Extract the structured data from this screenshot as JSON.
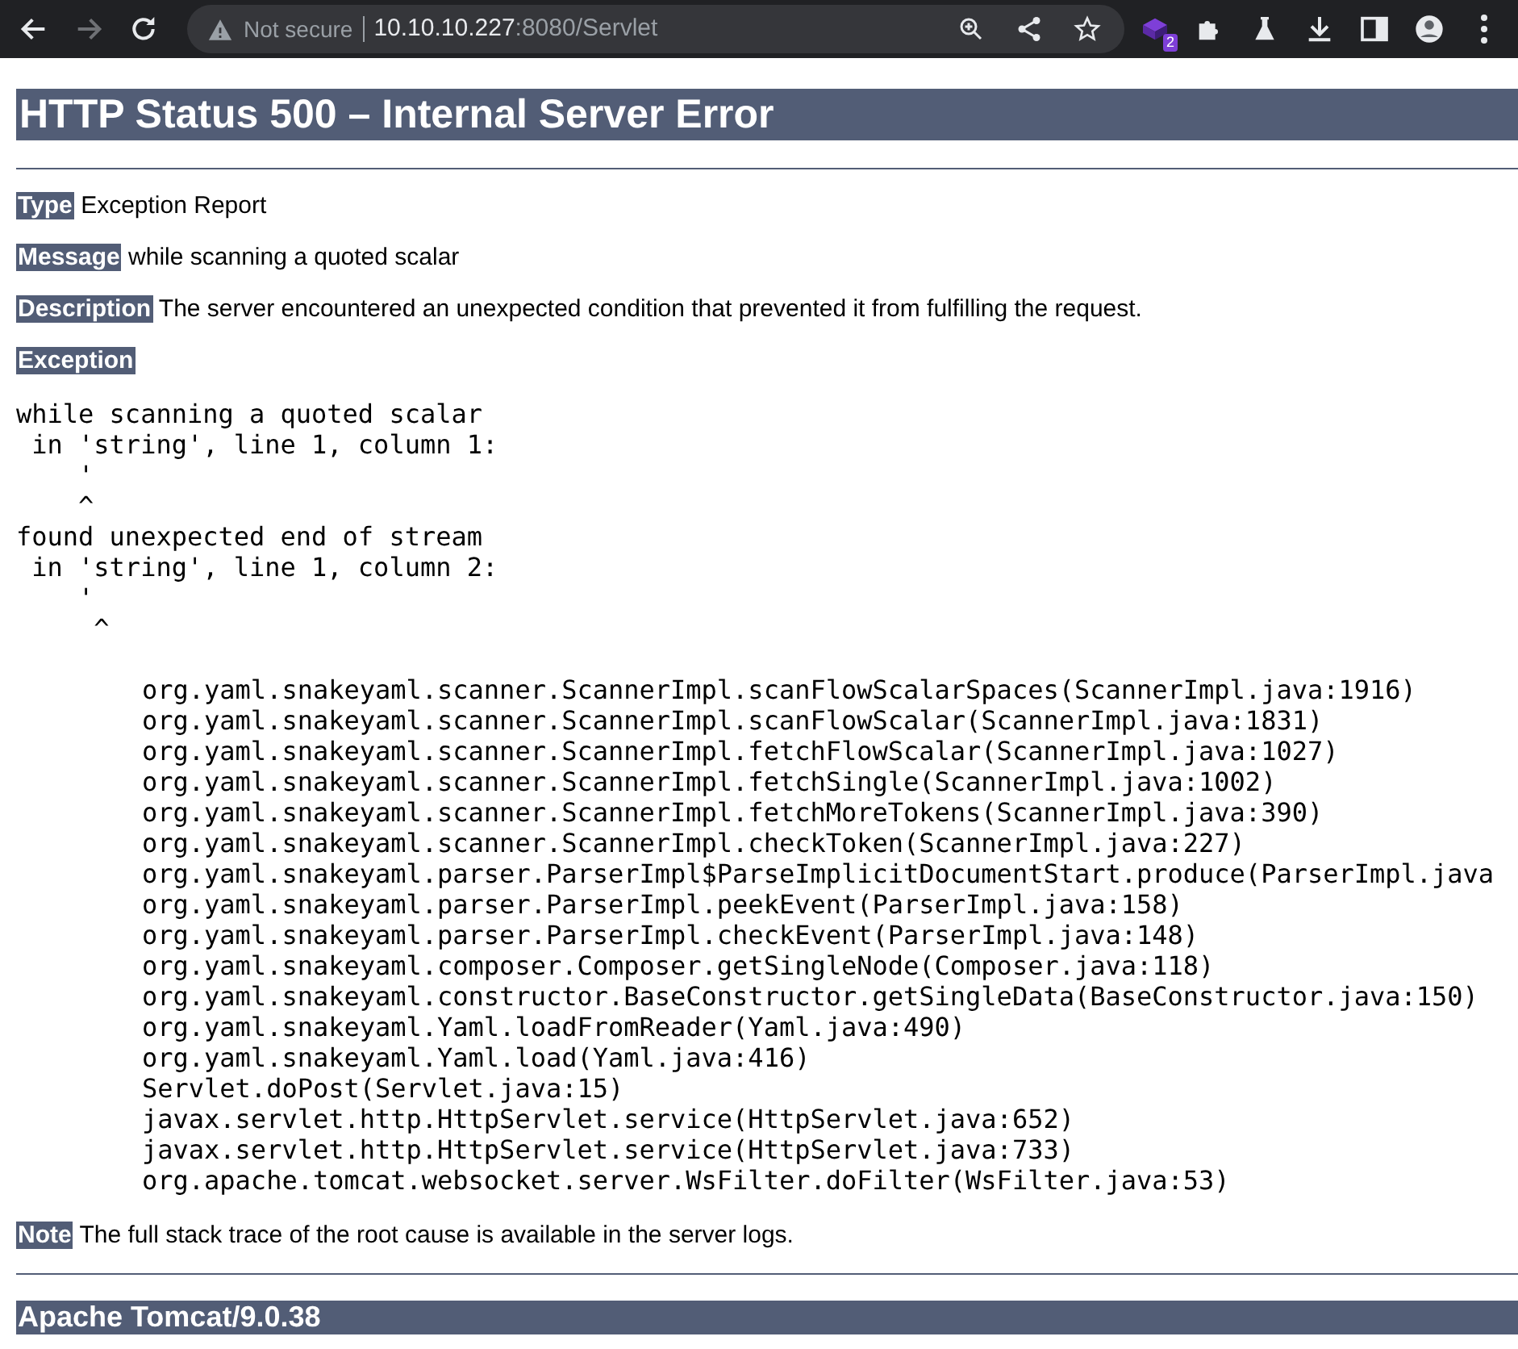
{
  "browser": {
    "nav_buttons": [
      {
        "kind": "back",
        "disabled": false
      },
      {
        "kind": "forward",
        "disabled": true
      },
      {
        "kind": "reload",
        "disabled": false
      }
    ],
    "security": "Not secure",
    "url_host": "10.10.10.227",
    "url_rest": ":8080/Servlet",
    "extension_badge": "2"
  },
  "page": {
    "title": "HTTP Status 500 – Internal Server Error",
    "fields": [
      {
        "label": "Type",
        "text": "Exception Report"
      },
      {
        "label": "Message",
        "text": "while scanning a quoted scalar"
      },
      {
        "label": "Description",
        "text": "The server encountered an unexpected condition that prevented it from fulfilling the request."
      }
    ],
    "exception_label": "Exception",
    "exception_message": [
      "while scanning a quoted scalar",
      " in 'string', line 1, column 1:",
      "    '",
      "    ^",
      "found unexpected end of stream",
      " in 'string', line 1, column 2:",
      "    '",
      "     ^"
    ],
    "stack_trace": [
      "org.yaml.snakeyaml.scanner.ScannerImpl.scanFlowScalarSpaces(ScannerImpl.java:1916)",
      "org.yaml.snakeyaml.scanner.ScannerImpl.scanFlowScalar(ScannerImpl.java:1831)",
      "org.yaml.snakeyaml.scanner.ScannerImpl.fetchFlowScalar(ScannerImpl.java:1027)",
      "org.yaml.snakeyaml.scanner.ScannerImpl.fetchSingle(ScannerImpl.java:1002)",
      "org.yaml.snakeyaml.scanner.ScannerImpl.fetchMoreTokens(ScannerImpl.java:390)",
      "org.yaml.snakeyaml.scanner.ScannerImpl.checkToken(ScannerImpl.java:227)",
      "org.yaml.snakeyaml.parser.ParserImpl$ParseImplicitDocumentStart.produce(ParserImpl.java",
      "org.yaml.snakeyaml.parser.ParserImpl.peekEvent(ParserImpl.java:158)",
      "org.yaml.snakeyaml.parser.ParserImpl.checkEvent(ParserImpl.java:148)",
      "org.yaml.snakeyaml.composer.Composer.getSingleNode(Composer.java:118)",
      "org.yaml.snakeyaml.constructor.BaseConstructor.getSingleData(BaseConstructor.java:150)",
      "org.yaml.snakeyaml.Yaml.loadFromReader(Yaml.java:490)",
      "org.yaml.snakeyaml.Yaml.load(Yaml.java:416)",
      "Servlet.doPost(Servlet.java:15)",
      "javax.servlet.http.HttpServlet.service(HttpServlet.java:652)",
      "javax.servlet.http.HttpServlet.service(HttpServlet.java:733)",
      "org.apache.tomcat.websocket.server.WsFilter.doFilter(WsFilter.java:53)"
    ],
    "note": {
      "label": "Note",
      "text": "The full stack trace of the root cause is available in the server logs."
    },
    "footer": "Apache Tomcat/9.0.38"
  }
}
